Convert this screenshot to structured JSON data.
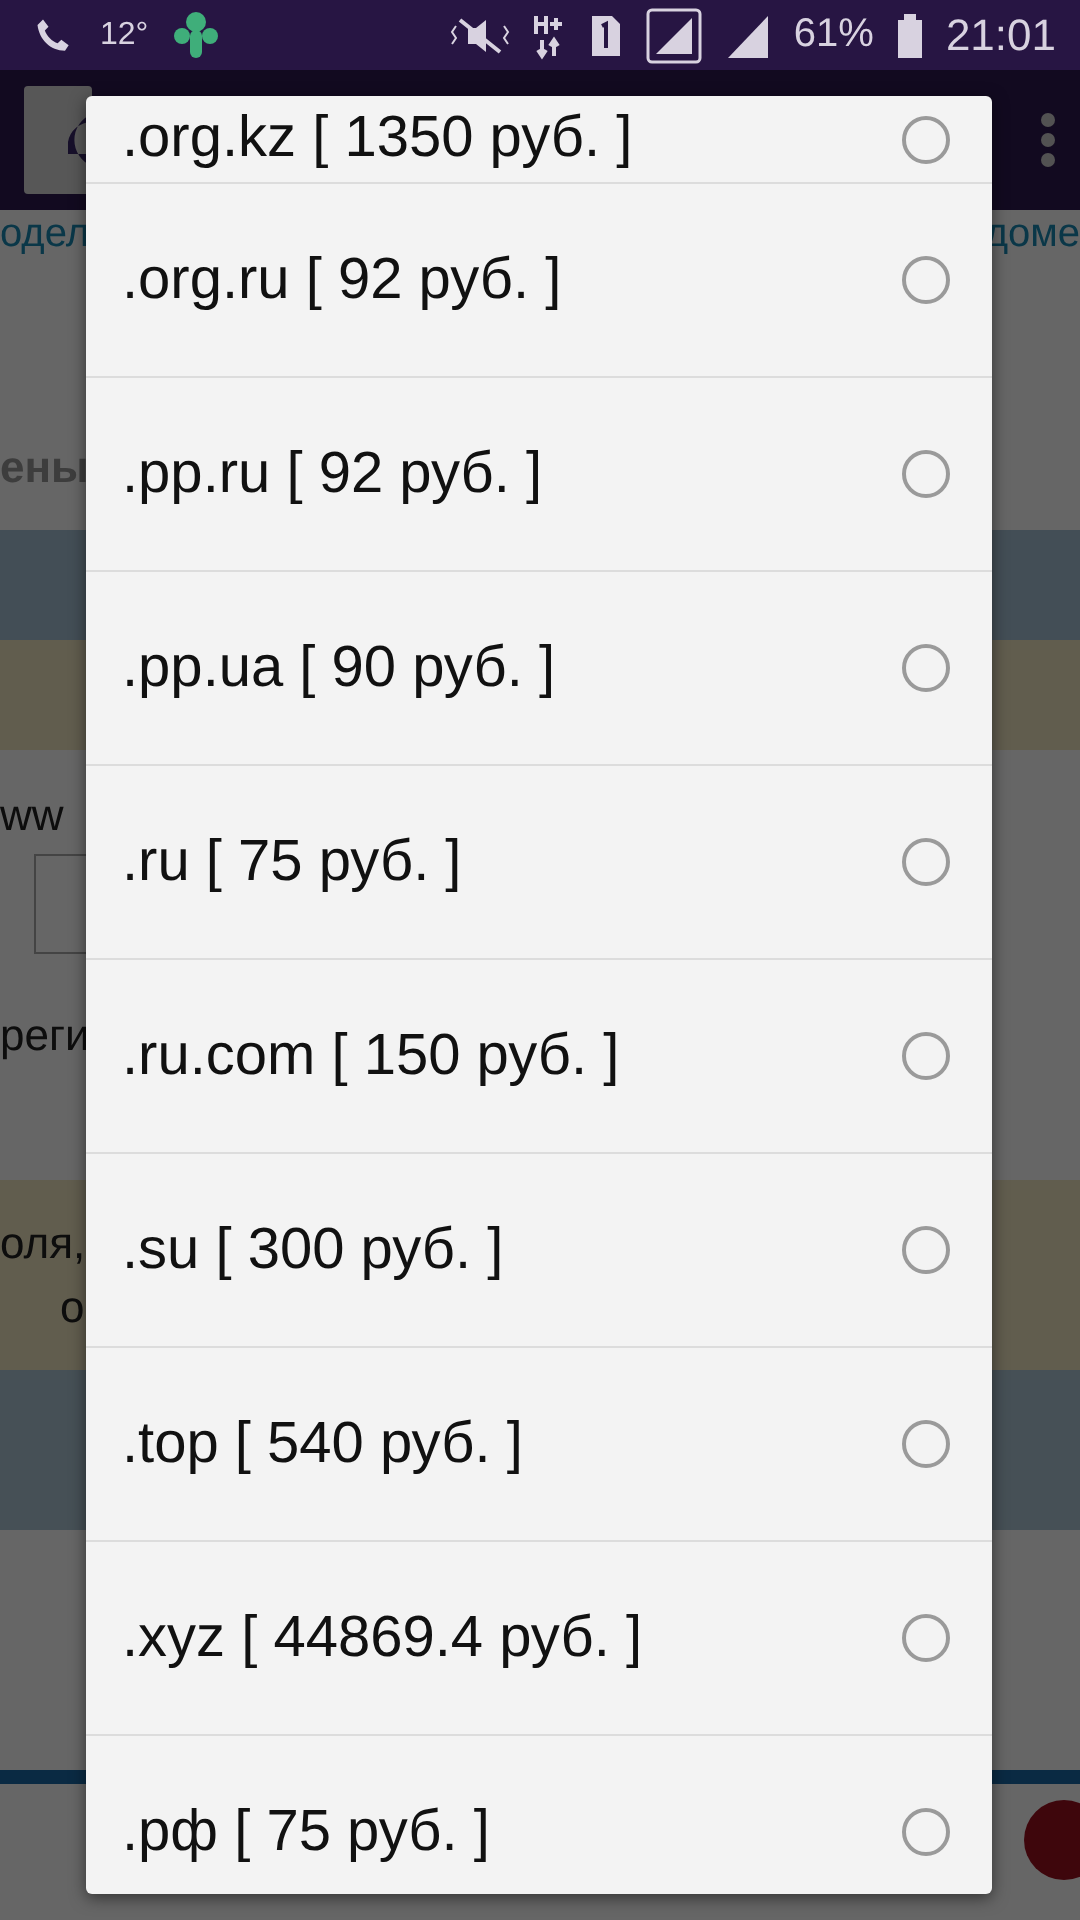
{
  "status_bar": {
    "temperature": "12°",
    "battery": "61%",
    "time": "21:01"
  },
  "background": {
    "link_left": "одел",
    "link_right": "доме",
    "heading": "ены",
    "domain_prefix": "ww",
    "register_text": "реги",
    "notice_lines": [
      "оля,",
      "о"
    ]
  },
  "dialog": {
    "options": [
      {
        "label": ".org.kz [ 1350 руб. ]",
        "selected": false
      },
      {
        "label": ".org.ru [ 92 руб. ]",
        "selected": false
      },
      {
        "label": ".pp.ru [ 92 руб. ]",
        "selected": false
      },
      {
        "label": ".pp.ua [ 90 руб. ]",
        "selected": false
      },
      {
        "label": ".ru [ 75 руб. ]",
        "selected": false
      },
      {
        "label": ".ru.com [ 150 руб. ]",
        "selected": false
      },
      {
        "label": ".su [ 300 руб. ]",
        "selected": false
      },
      {
        "label": ".top [ 540 руб. ]",
        "selected": false
      },
      {
        "label": ".xyz [ 44869.4 руб. ]",
        "selected": false
      },
      {
        "label": ".рф [ 75 руб. ]",
        "selected": false
      }
    ]
  }
}
